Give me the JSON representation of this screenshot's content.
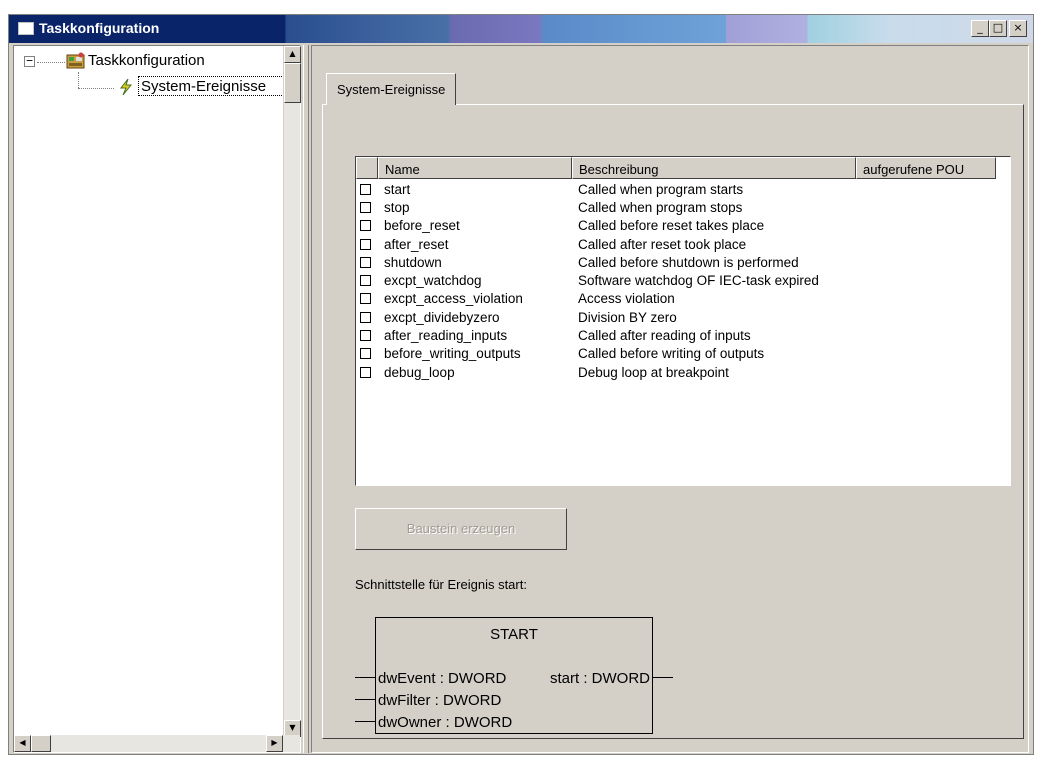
{
  "window": {
    "title": "Taskkonfiguration",
    "buttons": {
      "minimize": "_",
      "maximize": "□",
      "close": "×"
    }
  },
  "tree": {
    "root_label": "Taskkonfiguration",
    "expander": "−",
    "child_label": "System-Ereignisse",
    "root_icon": "task-config-icon",
    "child_icon": "lightning-icon"
  },
  "tab": {
    "label": "System-Ereignisse"
  },
  "events_table": {
    "columns": [
      "Name",
      "Beschreibung",
      "aufgerufene POU"
    ],
    "rows": [
      {
        "name": "start",
        "description": "Called when program starts",
        "pou": ""
      },
      {
        "name": "stop",
        "description": "Called when program stops",
        "pou": ""
      },
      {
        "name": "before_reset",
        "description": "Called before reset takes place",
        "pou": ""
      },
      {
        "name": "after_reset",
        "description": "Called after reset took place",
        "pou": ""
      },
      {
        "name": "shutdown",
        "description": "Called before shutdown is performed",
        "pou": ""
      },
      {
        "name": "excpt_watchdog",
        "description": "Software watchdog OF IEC-task expired",
        "pou": ""
      },
      {
        "name": "excpt_access_violation",
        "description": "Access violation",
        "pou": ""
      },
      {
        "name": "excpt_dividebyzero",
        "description": "Division BY zero",
        "pou": ""
      },
      {
        "name": "after_reading_inputs",
        "description": "Called after reading of inputs",
        "pou": ""
      },
      {
        "name": "before_writing_outputs",
        "description": "Called before writing of outputs",
        "pou": ""
      },
      {
        "name": "debug_loop",
        "description": "Debug loop at breakpoint",
        "pou": ""
      }
    ]
  },
  "create_button": {
    "label": "Baustein erzeugen",
    "enabled": false
  },
  "interface": {
    "label": "Schnittstelle für Ereignis start:",
    "block_name": "START",
    "inputs": [
      "dwEvent : DWORD",
      "dwFilter : DWORD",
      "dwOwner : DWORD"
    ],
    "outputs": [
      "start : DWORD"
    ]
  },
  "colors": {
    "titlebar_start": "#0a246a",
    "face": "#d4d0c8",
    "disabled_text": "#a09c94"
  }
}
